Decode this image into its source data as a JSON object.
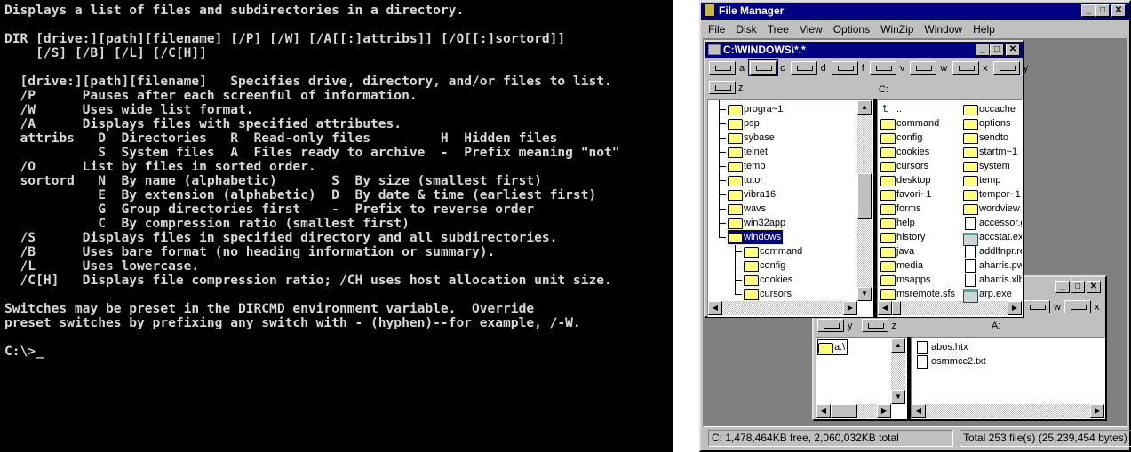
{
  "console": {
    "lines": [
      "Displays a list of files and subdirectories in a directory.",
      "",
      "DIR [drive:][path][filename] [/P] [/W] [/A[[:]attribs]] [/O[[:]sortord]]",
      "    [/S] [/B] [/L] [/C[H]]",
      "",
      "  [drive:][path][filename]   Specifies drive, directory, and/or files to list.",
      "  /P      Pauses after each screenful of information.",
      "  /W      Uses wide list format.",
      "  /A      Displays files with specified attributes.",
      "  attribs   D  Directories   R  Read-only files         H  Hidden files",
      "            S  System files  A  Files ready to archive  -  Prefix meaning \"not\"",
      "  /O      List by files in sorted order.",
      "  sortord   N  By name (alphabetic)       S  By size (smallest first)",
      "            E  By extension (alphabetic)  D  By date & time (earliest first)",
      "            G  Group directories first    -  Prefix to reverse order",
      "            C  By compression ratio (smallest first)",
      "  /S      Displays files in specified directory and all subdirectories.",
      "  /B      Uses bare format (no heading information or summary).",
      "  /L      Uses lowercase.",
      "  /C[H]   Displays file compression ratio; /CH uses host allocation unit size.",
      "",
      "Switches may be preset in the DIRCMD environment variable.  Override",
      "preset switches by prefixing any switch with - (hyphen)--for example, /-W.",
      "",
      "C:\\>_"
    ]
  },
  "app": {
    "title": "File Manager",
    "menu": [
      "File",
      "Disk",
      "Tree",
      "View",
      "Options",
      "WinZip",
      "Window",
      "Help"
    ],
    "controls": {
      "minimize": "_",
      "maximize": "□",
      "close": "✕"
    }
  },
  "win_c": {
    "title": "C:\\WINDOWS\\*.*",
    "drives": [
      "a",
      "c",
      "d",
      "f",
      "v",
      "w",
      "x",
      "y",
      "z"
    ],
    "selected_drive": "c",
    "current_drive_label": "C:",
    "tree": [
      {
        "name": "progra~1"
      },
      {
        "name": "psp"
      },
      {
        "name": "sybase"
      },
      {
        "name": "telnet"
      },
      {
        "name": "temp"
      },
      {
        "name": "tutor"
      },
      {
        "name": "vibra16"
      },
      {
        "name": "wavs"
      },
      {
        "name": "win32app"
      },
      {
        "name": "windows",
        "selected": true
      },
      {
        "name": "command",
        "child": true
      },
      {
        "name": "config",
        "child": true
      },
      {
        "name": "cookies",
        "child": true
      },
      {
        "name": "cursors",
        "child": true
      }
    ],
    "files_col1": [
      {
        "name": "..",
        "type": "up"
      },
      {
        "name": "command",
        "type": "folder"
      },
      {
        "name": "config",
        "type": "folder"
      },
      {
        "name": "cookies",
        "type": "folder"
      },
      {
        "name": "cursors",
        "type": "folder"
      },
      {
        "name": "desktop",
        "type": "folder"
      },
      {
        "name": "favori~1",
        "type": "folder"
      },
      {
        "name": "forms",
        "type": "folder"
      },
      {
        "name": "help",
        "type": "folder"
      },
      {
        "name": "history",
        "type": "folder"
      },
      {
        "name": "java",
        "type": "folder"
      },
      {
        "name": "media",
        "type": "folder"
      },
      {
        "name": "msapps",
        "type": "folder"
      },
      {
        "name": "msremote.sfs",
        "type": "folder"
      }
    ],
    "files_col2": [
      {
        "name": "occache",
        "type": "folder"
      },
      {
        "name": "options",
        "type": "folder"
      },
      {
        "name": "sendto",
        "type": "folder"
      },
      {
        "name": "startm~1",
        "type": "folder"
      },
      {
        "name": "system",
        "type": "folder"
      },
      {
        "name": "temp",
        "type": "folder"
      },
      {
        "name": "tempor~1",
        "type": "folder"
      },
      {
        "name": "wordview",
        "type": "folder"
      },
      {
        "name": "accessor.g",
        "type": "file"
      },
      {
        "name": "accstat.exe",
        "type": "exe"
      },
      {
        "name": "addlfnpr.reg",
        "type": "file"
      },
      {
        "name": "aharris.pwl",
        "type": "file"
      },
      {
        "name": "aharris.xlb",
        "type": "file"
      },
      {
        "name": "arp.exe",
        "type": "exe"
      }
    ]
  },
  "win_a": {
    "drives_row1": [
      "w",
      "x"
    ],
    "drives_row2": [
      "y",
      "z"
    ],
    "current_drive_label": "A:",
    "tree": [
      {
        "name": "a:\\"
      }
    ],
    "files": [
      {
        "name": "abos.htx",
        "type": "file"
      },
      {
        "name": "osmmcc2.txt",
        "type": "file"
      }
    ]
  },
  "status": {
    "left": "C: 1,478,464KB free,  2,060,032KB total",
    "right": "Total 253 file(s) (25,239,454 bytes)"
  }
}
